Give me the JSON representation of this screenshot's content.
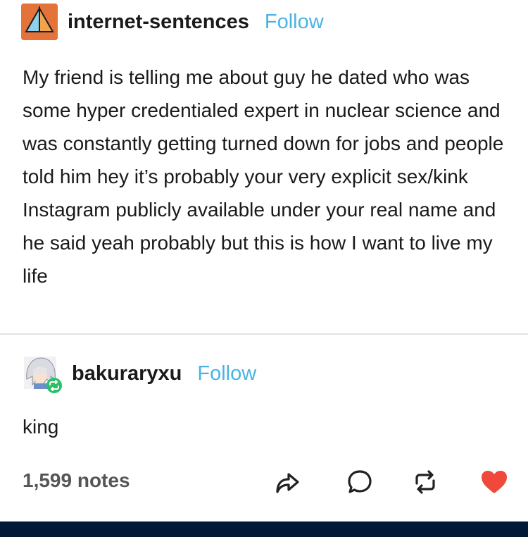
{
  "original_post": {
    "username": "internet-sentences",
    "follow_label": "Follow",
    "text": "My friend is telling me about guy he dated who was some hyper credentialed expert in nuclear science and was constantly getting turned down for jobs and people told him hey it’s probably your very explicit sex/kink Instagram publicly available under your real name and he said yeah probably but this is how I want to live my life"
  },
  "reblog": {
    "username": "bakuraryxu",
    "follow_label": "Follow",
    "text": "king",
    "reblog_badge_icon": "reblog-icon"
  },
  "footer": {
    "notes": "1,599 notes",
    "actions": [
      "share-icon",
      "reply-icon",
      "reblog-icon",
      "like-icon"
    ],
    "like_color": "#f0483a"
  },
  "colors": {
    "follow": "#4ab3e3",
    "bottom_bar": "#001935",
    "reblog_badge": "#2bbf6a"
  }
}
